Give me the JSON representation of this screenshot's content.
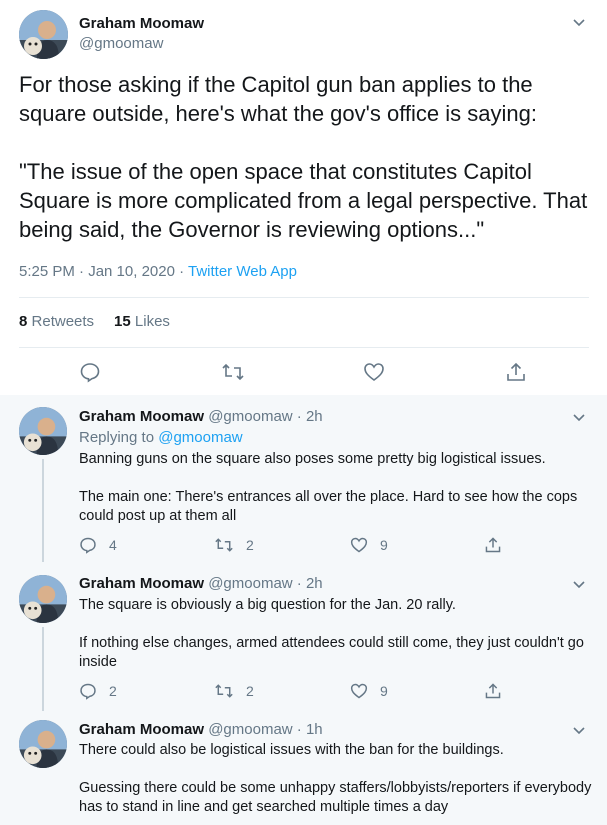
{
  "main": {
    "name": "Graham Moomaw",
    "handle": "@gmoomaw",
    "text": "For those asking if the Capitol gun ban applies to the square outside, here's what the gov's office is saying:\n\n\"The issue of the open space that constitutes Capitol Square is more complicated from a legal perspective. That being said, the Governor is reviewing options...\"",
    "time": "5:25 PM · Jan 10, 2020 · ",
    "via": "Twitter Web App",
    "retweets": "8",
    "retweets_label": "Retweets",
    "likes": "15",
    "likes_label": "Likes"
  },
  "replies": [
    {
      "name": "Graham Moomaw",
      "handle": "@gmoomaw · 2h",
      "replying_prefix": "Replying to ",
      "replying_to": "@gmoomaw",
      "text": "Banning guns on the square also poses some pretty big logistical issues.\n\nThe main one: There's entrances all over the place. Hard to see how the cops could post up at them all",
      "reply_count": "4",
      "retweet_count": "2",
      "like_count": "9"
    },
    {
      "name": "Graham Moomaw",
      "handle": "@gmoomaw · 2h",
      "text": "The square is obviously a big question for the Jan. 20 rally.\n\nIf nothing else changes, armed attendees could still come, they just couldn't go inside",
      "reply_count": "2",
      "retweet_count": "2",
      "like_count": "9"
    },
    {
      "name": "Graham Moomaw",
      "handle": "@gmoomaw · 1h",
      "text": "There could also be logistical issues with the ban for the buildings.\n\nGuessing there could be some unhappy staffers/lobbyists/reporters if everybody has to stand in line and get searched multiple times a day"
    }
  ],
  "icons": {
    "reply": "reply-icon",
    "retweet": "retweet-icon",
    "like": "like-icon",
    "share": "share-icon",
    "more": "chevron-down-icon"
  },
  "colors": {
    "accent": "#1da1f2",
    "text": "#14171a",
    "muted": "#657786",
    "reply_bg": "#f5f8fa"
  }
}
